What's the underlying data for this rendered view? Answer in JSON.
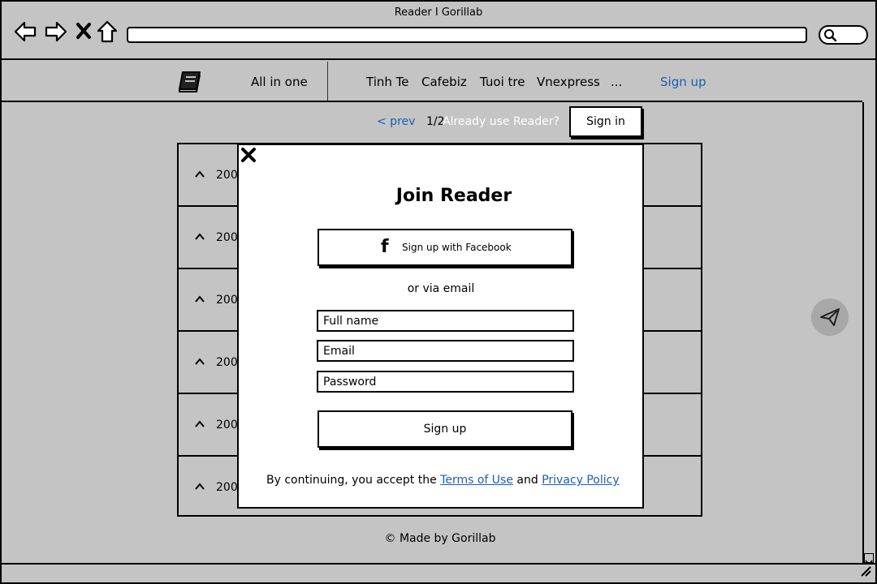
{
  "browser": {
    "title": "Reader I Gorillab",
    "icons": [
      "back-icon",
      "forward-icon",
      "stop-icon",
      "home-icon",
      "search-icon"
    ]
  },
  "navbar": {
    "logo_icon": "book-icon",
    "all_label": "All in one",
    "sources": [
      "Tinh Te",
      "Cafebiz",
      "Tuoi tre",
      "Vnexpress",
      "..."
    ],
    "signup_label": "Sign up"
  },
  "subheader": {
    "prev_label": "< prev",
    "page_count": "1/2",
    "already_label": "Already use Reader?",
    "signin_label": "Sign in"
  },
  "list": {
    "rows": [
      "200",
      "200",
      "200",
      "200",
      "200",
      "200"
    ]
  },
  "footer": {
    "text": "© Made by Gorillab"
  },
  "modal": {
    "title": "Join Reader",
    "facebook_label": "Sign up with Facebook",
    "or_email": "or via email",
    "fullname_placeholder": "Full name",
    "email_placeholder": "Email",
    "password_placeholder": "Password",
    "submit_label": "Sign up",
    "legal_prefix": "By continuing, you accept the",
    "terms_label": "Terms of Use",
    "legal_and": "and",
    "privacy_label": " Privacy Policy"
  },
  "colors": {
    "background": "#c4c4c4",
    "link": "#1a5fb4",
    "modal": "#ffffff"
  }
}
